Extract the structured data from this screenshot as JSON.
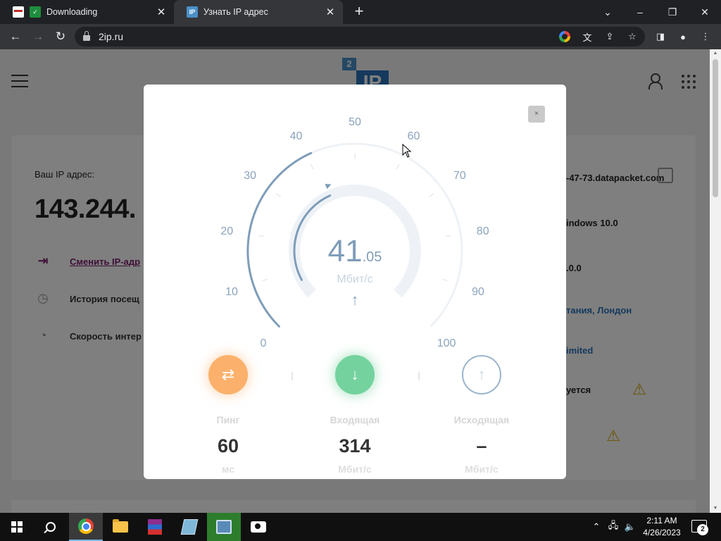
{
  "browser": {
    "tabs": [
      {
        "title": "Downloading",
        "favicon": "download-check-icon",
        "active": false
      },
      {
        "title": "Узнать IP адрес",
        "favicon": "ip-favicon",
        "active": true
      }
    ],
    "url": "2ip.ru",
    "new_tab_symbol": "+",
    "window_controls": {
      "minimize": "–",
      "restore": "❐",
      "close": "✕"
    }
  },
  "site": {
    "logo": {
      "top": "2",
      "main": "IP"
    },
    "ip_label": "Ваш IP адрес:",
    "ip_value": "143.244.",
    "menu": [
      {
        "label": "Сменить IP-адр",
        "icon": "change-ip-icon",
        "link": true
      },
      {
        "label": "История посещ",
        "icon": "history-icon",
        "link": false
      },
      {
        "label": "Скорость интер",
        "icon": "speedometer-icon",
        "link": false
      }
    ],
    "right_info": [
      {
        "text": "-47-73.datapacket.com",
        "blue": false
      },
      {
        "text": "indows 10.0",
        "blue": false
      },
      {
        "text": ".0.0",
        "blue": false
      },
      {
        "text": "тания, Лондон",
        "blue": true
      },
      {
        "text": "imited",
        "blue": true
      },
      {
        "text": "уется",
        "blue": false
      }
    ]
  },
  "modal": {
    "close_label": "×",
    "gauge": {
      "value_int": "41",
      "value_dec": ".05",
      "unit": "Мбит/с",
      "value": 41.05,
      "min": 0,
      "max": 100,
      "ticks": [
        "0",
        "10",
        "20",
        "30",
        "40",
        "50",
        "60",
        "70",
        "80",
        "90",
        "100"
      ]
    },
    "stats": [
      {
        "label": "Пинг",
        "value": "60",
        "unit": "мс",
        "icon": "ping-arrows-icon"
      },
      {
        "label": "Входящая",
        "value": "314",
        "unit": "Мбит/с",
        "icon": "download-arrow-icon"
      },
      {
        "label": "Исходящая",
        "value": "–",
        "unit": "Мбит/с",
        "icon": "upload-arrow-icon"
      }
    ]
  },
  "taskbar": {
    "time": "2:11 AM",
    "date": "4/26/2023",
    "notifications": "2",
    "apps": [
      "start",
      "search",
      "chrome",
      "file-explorer",
      "winrar",
      "notepad",
      "network-tool",
      "camera"
    ]
  },
  "colors": {
    "ping": "#fbb16c",
    "download": "#74d29e",
    "gauge": "#7f9db9",
    "link": "#7b1e6e",
    "overlay": "rgba(0,0,0,0.5)"
  }
}
